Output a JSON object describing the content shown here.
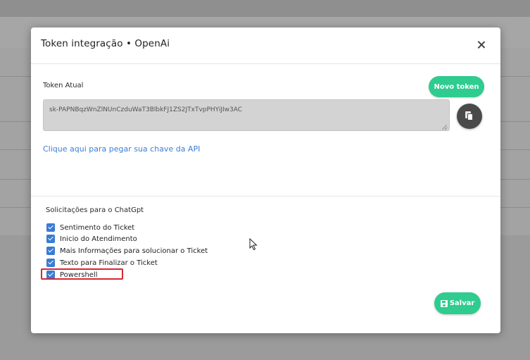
{
  "modal": {
    "title": "Token integração • OpenAi",
    "token_label": "Token Atual",
    "new_token_label": "Novo token",
    "token_value": "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",
    "api_link": "Clique aqui para pegar sua chave da API",
    "requests_label": "Solicitações para o ChatGpt",
    "checkboxes": [
      {
        "label": "Sentimento do Ticket",
        "checked": true
      },
      {
        "label": "Inicio do Atendimento",
        "checked": true
      },
      {
        "label": "Mais Informações para solucionar o Ticket",
        "checked": true
      },
      {
        "label": "Texto para Finalizar o Ticket",
        "checked": true
      },
      {
        "label": "Powershell",
        "checked": true
      }
    ],
    "save_label": "Salvar"
  },
  "colors": {
    "accent_green": "#2ecc8f",
    "checkbox_blue": "#3a7bd5",
    "link_blue": "#3b7dd8",
    "highlight_red": "#d8262f"
  },
  "icons": [
    "close-icon",
    "copy-icon",
    "save-icon",
    "check-icon",
    "mouse-cursor-icon"
  ]
}
